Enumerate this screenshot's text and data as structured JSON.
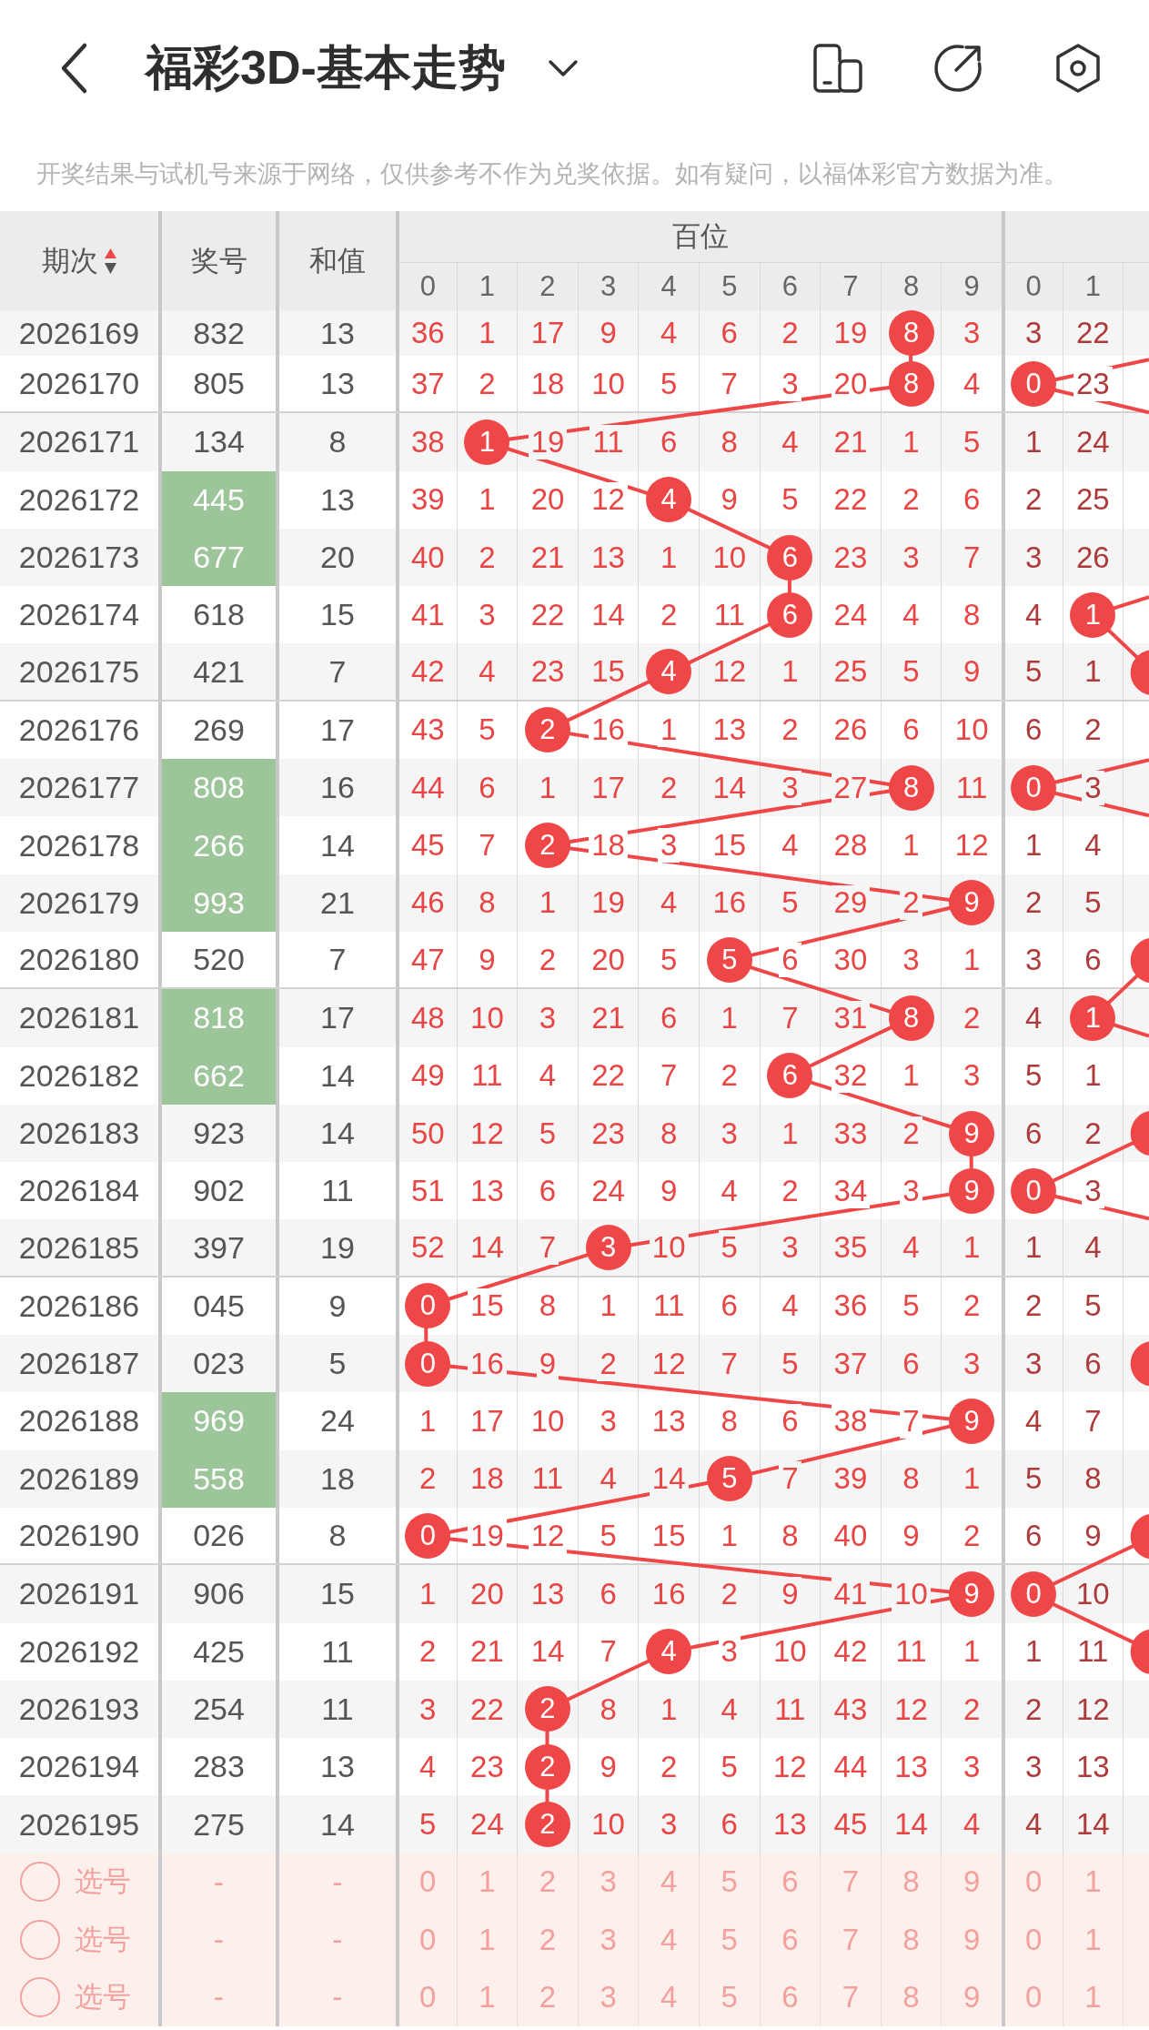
{
  "header": {
    "title": "福彩3D-基本走势"
  },
  "notice": "开奖结果与试机号来源于网络，仅供参考不作为兑奖依据。如有疑问，以福体彩官方数据为准。",
  "table": {
    "columns": [
      {
        "label": "期次",
        "sort_ascending": true
      },
      {
        "label": "奖号"
      },
      {
        "label": "和值"
      }
    ],
    "digit_groups": [
      {
        "label": "百位",
        "digits": [
          "0",
          "1",
          "2",
          "3",
          "4",
          "5",
          "6",
          "7",
          "8",
          "9"
        ]
      },
      {
        "digits": [
          "0",
          "1"
        ]
      }
    ],
    "rows": [
      {
        "period": "2026169",
        "number": "832",
        "highlighted": false,
        "sum": "13",
        "section_end": false,
        "hundreds": [
          {
            "value": "36",
            "hit": false
          },
          {
            "value": "1",
            "hit": false
          },
          {
            "value": "17",
            "hit": false
          },
          {
            "value": "9",
            "hit": false
          },
          {
            "value": "4",
            "hit": false
          },
          {
            "value": "6",
            "hit": false
          },
          {
            "value": "2",
            "hit": false
          },
          {
            "value": "19",
            "hit": false
          },
          {
            "value": "8",
            "hit": true
          },
          {
            "value": "3",
            "hit": false
          }
        ],
        "tens": [
          {
            "value": "3",
            "hit": false
          },
          {
            "value": "22",
            "hit": false
          },
          {
            "hit": false
          }
        ]
      },
      {
        "period": "2026170",
        "number": "805",
        "highlighted": false,
        "sum": "13",
        "section_end": true,
        "hundreds": [
          {
            "value": "37",
            "hit": false
          },
          {
            "value": "2",
            "hit": false
          },
          {
            "value": "18",
            "hit": false
          },
          {
            "value": "10",
            "hit": false
          },
          {
            "value": "5",
            "hit": false
          },
          {
            "value": "7",
            "hit": false
          },
          {
            "value": "3",
            "hit": false
          },
          {
            "value": "20",
            "hit": false
          },
          {
            "value": "8",
            "hit": true
          },
          {
            "value": "4",
            "hit": false
          }
        ],
        "tens": [
          {
            "value": "0",
            "hit": true
          },
          {
            "value": "23",
            "hit": false
          },
          {
            "hit": false
          }
        ]
      },
      {
        "period": "2026171",
        "number": "134",
        "highlighted": false,
        "sum": "8",
        "section_end": false,
        "hundreds": [
          {
            "value": "38",
            "hit": false
          },
          {
            "value": "1",
            "hit": true
          },
          {
            "value": "19",
            "hit": false
          },
          {
            "value": "11",
            "hit": false
          },
          {
            "value": "6",
            "hit": false
          },
          {
            "value": "8",
            "hit": false
          },
          {
            "value": "4",
            "hit": false
          },
          {
            "value": "21",
            "hit": false
          },
          {
            "value": "1",
            "hit": false
          },
          {
            "value": "5",
            "hit": false
          }
        ],
        "tens": [
          {
            "value": "1",
            "hit": false
          },
          {
            "value": "24",
            "hit": false
          },
          {
            "hit": false
          }
        ]
      },
      {
        "period": "2026172",
        "number": "445",
        "highlighted": true,
        "sum": "13",
        "section_end": false,
        "hundreds": [
          {
            "value": "39",
            "hit": false
          },
          {
            "value": "1",
            "hit": false
          },
          {
            "value": "20",
            "hit": false
          },
          {
            "value": "12",
            "hit": false
          },
          {
            "value": "4",
            "hit": true
          },
          {
            "value": "9",
            "hit": false
          },
          {
            "value": "5",
            "hit": false
          },
          {
            "value": "22",
            "hit": false
          },
          {
            "value": "2",
            "hit": false
          },
          {
            "value": "6",
            "hit": false
          }
        ],
        "tens": [
          {
            "value": "2",
            "hit": false
          },
          {
            "value": "25",
            "hit": false
          },
          {
            "hit": false
          }
        ]
      },
      {
        "period": "2026173",
        "number": "677",
        "highlighted": true,
        "sum": "20",
        "section_end": false,
        "hundreds": [
          {
            "value": "40",
            "hit": false
          },
          {
            "value": "2",
            "hit": false
          },
          {
            "value": "21",
            "hit": false
          },
          {
            "value": "13",
            "hit": false
          },
          {
            "value": "1",
            "hit": false
          },
          {
            "value": "10",
            "hit": false
          },
          {
            "value": "6",
            "hit": true
          },
          {
            "value": "23",
            "hit": false
          },
          {
            "value": "3",
            "hit": false
          },
          {
            "value": "7",
            "hit": false
          }
        ],
        "tens": [
          {
            "value": "3",
            "hit": false
          },
          {
            "value": "26",
            "hit": false
          },
          {
            "hit": false
          }
        ]
      },
      {
        "period": "2026174",
        "number": "618",
        "highlighted": false,
        "sum": "15",
        "section_end": false,
        "hundreds": [
          {
            "value": "41",
            "hit": false
          },
          {
            "value": "3",
            "hit": false
          },
          {
            "value": "22",
            "hit": false
          },
          {
            "value": "14",
            "hit": false
          },
          {
            "value": "2",
            "hit": false
          },
          {
            "value": "11",
            "hit": false
          },
          {
            "value": "6",
            "hit": true
          },
          {
            "value": "24",
            "hit": false
          },
          {
            "value": "4",
            "hit": false
          },
          {
            "value": "8",
            "hit": false
          }
        ],
        "tens": [
          {
            "value": "4",
            "hit": false
          },
          {
            "value": "1",
            "hit": true
          },
          {
            "hit": false
          }
        ]
      },
      {
        "period": "2026175",
        "number": "421",
        "highlighted": false,
        "sum": "7",
        "section_end": true,
        "hundreds": [
          {
            "value": "42",
            "hit": false
          },
          {
            "value": "4",
            "hit": false
          },
          {
            "value": "23",
            "hit": false
          },
          {
            "value": "15",
            "hit": false
          },
          {
            "value": "4",
            "hit": true
          },
          {
            "value": "12",
            "hit": false
          },
          {
            "value": "1",
            "hit": false
          },
          {
            "value": "25",
            "hit": false
          },
          {
            "value": "5",
            "hit": false
          },
          {
            "value": "9",
            "hit": false
          }
        ],
        "tens": [
          {
            "value": "5",
            "hit": false
          },
          {
            "value": "1",
            "hit": false
          },
          {
            "hit": true
          }
        ]
      },
      {
        "period": "2026176",
        "number": "269",
        "highlighted": false,
        "sum": "17",
        "section_end": false,
        "hundreds": [
          {
            "value": "43",
            "hit": false
          },
          {
            "value": "5",
            "hit": false
          },
          {
            "value": "2",
            "hit": true
          },
          {
            "value": "16",
            "hit": false
          },
          {
            "value": "1",
            "hit": false
          },
          {
            "value": "13",
            "hit": false
          },
          {
            "value": "2",
            "hit": false
          },
          {
            "value": "26",
            "hit": false
          },
          {
            "value": "6",
            "hit": false
          },
          {
            "value": "10",
            "hit": false
          }
        ],
        "tens": [
          {
            "value": "6",
            "hit": false
          },
          {
            "value": "2",
            "hit": false
          },
          {
            "hit": false
          }
        ]
      },
      {
        "period": "2026177",
        "number": "808",
        "highlighted": true,
        "sum": "16",
        "section_end": false,
        "hundreds": [
          {
            "value": "44",
            "hit": false
          },
          {
            "value": "6",
            "hit": false
          },
          {
            "value": "1",
            "hit": false
          },
          {
            "value": "17",
            "hit": false
          },
          {
            "value": "2",
            "hit": false
          },
          {
            "value": "14",
            "hit": false
          },
          {
            "value": "3",
            "hit": false
          },
          {
            "value": "27",
            "hit": false
          },
          {
            "value": "8",
            "hit": true
          },
          {
            "value": "11",
            "hit": false
          }
        ],
        "tens": [
          {
            "value": "0",
            "hit": true
          },
          {
            "value": "3",
            "hit": false
          },
          {
            "hit": false
          }
        ]
      },
      {
        "period": "2026178",
        "number": "266",
        "highlighted": true,
        "sum": "14",
        "section_end": false,
        "hundreds": [
          {
            "value": "45",
            "hit": false
          },
          {
            "value": "7",
            "hit": false
          },
          {
            "value": "2",
            "hit": true
          },
          {
            "value": "18",
            "hit": false
          },
          {
            "value": "3",
            "hit": false
          },
          {
            "value": "15",
            "hit": false
          },
          {
            "value": "4",
            "hit": false
          },
          {
            "value": "28",
            "hit": false
          },
          {
            "value": "1",
            "hit": false
          },
          {
            "value": "12",
            "hit": false
          }
        ],
        "tens": [
          {
            "value": "1",
            "hit": false
          },
          {
            "value": "4",
            "hit": false
          },
          {
            "hit": false
          }
        ]
      },
      {
        "period": "2026179",
        "number": "993",
        "highlighted": true,
        "sum": "21",
        "section_end": false,
        "hundreds": [
          {
            "value": "46",
            "hit": false
          },
          {
            "value": "8",
            "hit": false
          },
          {
            "value": "1",
            "hit": false
          },
          {
            "value": "19",
            "hit": false
          },
          {
            "value": "4",
            "hit": false
          },
          {
            "value": "16",
            "hit": false
          },
          {
            "value": "5",
            "hit": false
          },
          {
            "value": "29",
            "hit": false
          },
          {
            "value": "2",
            "hit": false
          },
          {
            "value": "9",
            "hit": true
          }
        ],
        "tens": [
          {
            "value": "2",
            "hit": false
          },
          {
            "value": "5",
            "hit": false
          },
          {
            "hit": false
          }
        ]
      },
      {
        "period": "2026180",
        "number": "520",
        "highlighted": false,
        "sum": "7",
        "section_end": true,
        "hundreds": [
          {
            "value": "47",
            "hit": false
          },
          {
            "value": "9",
            "hit": false
          },
          {
            "value": "2",
            "hit": false
          },
          {
            "value": "20",
            "hit": false
          },
          {
            "value": "5",
            "hit": false
          },
          {
            "value": "5",
            "hit": true
          },
          {
            "value": "6",
            "hit": false
          },
          {
            "value": "30",
            "hit": false
          },
          {
            "value": "3",
            "hit": false
          },
          {
            "value": "1",
            "hit": false
          }
        ],
        "tens": [
          {
            "value": "3",
            "hit": false
          },
          {
            "value": "6",
            "hit": false
          },
          {
            "hit": true
          }
        ]
      },
      {
        "period": "2026181",
        "number": "818",
        "highlighted": true,
        "sum": "17",
        "section_end": false,
        "hundreds": [
          {
            "value": "48",
            "hit": false
          },
          {
            "value": "10",
            "hit": false
          },
          {
            "value": "3",
            "hit": false
          },
          {
            "value": "21",
            "hit": false
          },
          {
            "value": "6",
            "hit": false
          },
          {
            "value": "1",
            "hit": false
          },
          {
            "value": "7",
            "hit": false
          },
          {
            "value": "31",
            "hit": false
          },
          {
            "value": "8",
            "hit": true
          },
          {
            "value": "2",
            "hit": false
          }
        ],
        "tens": [
          {
            "value": "4",
            "hit": false
          },
          {
            "value": "1",
            "hit": true
          },
          {
            "hit": false
          }
        ]
      },
      {
        "period": "2026182",
        "number": "662",
        "highlighted": true,
        "sum": "14",
        "section_end": false,
        "hundreds": [
          {
            "value": "49",
            "hit": false
          },
          {
            "value": "11",
            "hit": false
          },
          {
            "value": "4",
            "hit": false
          },
          {
            "value": "22",
            "hit": false
          },
          {
            "value": "7",
            "hit": false
          },
          {
            "value": "2",
            "hit": false
          },
          {
            "value": "6",
            "hit": true
          },
          {
            "value": "32",
            "hit": false
          },
          {
            "value": "1",
            "hit": false
          },
          {
            "value": "3",
            "hit": false
          }
        ],
        "tens": [
          {
            "value": "5",
            "hit": false
          },
          {
            "value": "1",
            "hit": false
          },
          {
            "hit": false
          }
        ]
      },
      {
        "period": "2026183",
        "number": "923",
        "highlighted": false,
        "sum": "14",
        "section_end": false,
        "hundreds": [
          {
            "value": "50",
            "hit": false
          },
          {
            "value": "12",
            "hit": false
          },
          {
            "value": "5",
            "hit": false
          },
          {
            "value": "23",
            "hit": false
          },
          {
            "value": "8",
            "hit": false
          },
          {
            "value": "3",
            "hit": false
          },
          {
            "value": "1",
            "hit": false
          },
          {
            "value": "33",
            "hit": false
          },
          {
            "value": "2",
            "hit": false
          },
          {
            "value": "9",
            "hit": true
          }
        ],
        "tens": [
          {
            "value": "6",
            "hit": false
          },
          {
            "value": "2",
            "hit": false
          },
          {
            "hit": true
          }
        ]
      },
      {
        "period": "2026184",
        "number": "902",
        "highlighted": false,
        "sum": "11",
        "section_end": false,
        "hundreds": [
          {
            "value": "51",
            "hit": false
          },
          {
            "value": "13",
            "hit": false
          },
          {
            "value": "6",
            "hit": false
          },
          {
            "value": "24",
            "hit": false
          },
          {
            "value": "9",
            "hit": false
          },
          {
            "value": "4",
            "hit": false
          },
          {
            "value": "2",
            "hit": false
          },
          {
            "value": "34",
            "hit": false
          },
          {
            "value": "3",
            "hit": false
          },
          {
            "value": "9",
            "hit": true
          }
        ],
        "tens": [
          {
            "value": "0",
            "hit": true
          },
          {
            "value": "3",
            "hit": false
          },
          {
            "hit": false
          }
        ]
      },
      {
        "period": "2026185",
        "number": "397",
        "highlighted": false,
        "sum": "19",
        "section_end": true,
        "hundreds": [
          {
            "value": "52",
            "hit": false
          },
          {
            "value": "14",
            "hit": false
          },
          {
            "value": "7",
            "hit": false
          },
          {
            "value": "3",
            "hit": true
          },
          {
            "value": "10",
            "hit": false
          },
          {
            "value": "5",
            "hit": false
          },
          {
            "value": "3",
            "hit": false
          },
          {
            "value": "35",
            "hit": false
          },
          {
            "value": "4",
            "hit": false
          },
          {
            "value": "1",
            "hit": false
          }
        ],
        "tens": [
          {
            "value": "1",
            "hit": false
          },
          {
            "value": "4",
            "hit": false
          },
          {
            "hit": false
          }
        ]
      },
      {
        "period": "2026186",
        "number": "045",
        "highlighted": false,
        "sum": "9",
        "section_end": false,
        "hundreds": [
          {
            "value": "0",
            "hit": true
          },
          {
            "value": "15",
            "hit": false
          },
          {
            "value": "8",
            "hit": false
          },
          {
            "value": "1",
            "hit": false
          },
          {
            "value": "11",
            "hit": false
          },
          {
            "value": "6",
            "hit": false
          },
          {
            "value": "4",
            "hit": false
          },
          {
            "value": "36",
            "hit": false
          },
          {
            "value": "5",
            "hit": false
          },
          {
            "value": "2",
            "hit": false
          }
        ],
        "tens": [
          {
            "value": "2",
            "hit": false
          },
          {
            "value": "5",
            "hit": false
          },
          {
            "hit": false
          }
        ]
      },
      {
        "period": "2026187",
        "number": "023",
        "highlighted": false,
        "sum": "5",
        "section_end": false,
        "hundreds": [
          {
            "value": "0",
            "hit": true
          },
          {
            "value": "16",
            "hit": false
          },
          {
            "value": "9",
            "hit": false
          },
          {
            "value": "2",
            "hit": false
          },
          {
            "value": "12",
            "hit": false
          },
          {
            "value": "7",
            "hit": false
          },
          {
            "value": "5",
            "hit": false
          },
          {
            "value": "37",
            "hit": false
          },
          {
            "value": "6",
            "hit": false
          },
          {
            "value": "3",
            "hit": false
          }
        ],
        "tens": [
          {
            "value": "3",
            "hit": false
          },
          {
            "value": "6",
            "hit": false
          },
          {
            "hit": true
          }
        ]
      },
      {
        "period": "2026188",
        "number": "969",
        "highlighted": true,
        "sum": "24",
        "section_end": false,
        "hundreds": [
          {
            "value": "1",
            "hit": false
          },
          {
            "value": "17",
            "hit": false
          },
          {
            "value": "10",
            "hit": false
          },
          {
            "value": "3",
            "hit": false
          },
          {
            "value": "13",
            "hit": false
          },
          {
            "value": "8",
            "hit": false
          },
          {
            "value": "6",
            "hit": false
          },
          {
            "value": "38",
            "hit": false
          },
          {
            "value": "7",
            "hit": false
          },
          {
            "value": "9",
            "hit": true
          }
        ],
        "tens": [
          {
            "value": "4",
            "hit": false
          },
          {
            "value": "7",
            "hit": false
          },
          {
            "hit": false
          }
        ]
      },
      {
        "period": "2026189",
        "number": "558",
        "highlighted": true,
        "sum": "18",
        "section_end": false,
        "hundreds": [
          {
            "value": "2",
            "hit": false
          },
          {
            "value": "18",
            "hit": false
          },
          {
            "value": "11",
            "hit": false
          },
          {
            "value": "4",
            "hit": false
          },
          {
            "value": "14",
            "hit": false
          },
          {
            "value": "5",
            "hit": true
          },
          {
            "value": "7",
            "hit": false
          },
          {
            "value": "39",
            "hit": false
          },
          {
            "value": "8",
            "hit": false
          },
          {
            "value": "1",
            "hit": false
          }
        ],
        "tens": [
          {
            "value": "5",
            "hit": false
          },
          {
            "value": "8",
            "hit": false
          },
          {
            "hit": false
          }
        ]
      },
      {
        "period": "2026190",
        "number": "026",
        "highlighted": false,
        "sum": "8",
        "section_end": true,
        "hundreds": [
          {
            "value": "0",
            "hit": true
          },
          {
            "value": "19",
            "hit": false
          },
          {
            "value": "12",
            "hit": false
          },
          {
            "value": "5",
            "hit": false
          },
          {
            "value": "15",
            "hit": false
          },
          {
            "value": "1",
            "hit": false
          },
          {
            "value": "8",
            "hit": false
          },
          {
            "value": "40",
            "hit": false
          },
          {
            "value": "9",
            "hit": false
          },
          {
            "value": "2",
            "hit": false
          }
        ],
        "tens": [
          {
            "value": "6",
            "hit": false
          },
          {
            "value": "9",
            "hit": false
          },
          {
            "hit": true
          }
        ]
      },
      {
        "period": "2026191",
        "number": "906",
        "highlighted": false,
        "sum": "15",
        "section_end": false,
        "hundreds": [
          {
            "value": "1",
            "hit": false
          },
          {
            "value": "20",
            "hit": false
          },
          {
            "value": "13",
            "hit": false
          },
          {
            "value": "6",
            "hit": false
          },
          {
            "value": "16",
            "hit": false
          },
          {
            "value": "2",
            "hit": false
          },
          {
            "value": "9",
            "hit": false
          },
          {
            "value": "41",
            "hit": false
          },
          {
            "value": "10",
            "hit": false
          },
          {
            "value": "9",
            "hit": true
          }
        ],
        "tens": [
          {
            "value": "0",
            "hit": true
          },
          {
            "value": "10",
            "hit": false
          },
          {
            "hit": false
          }
        ]
      },
      {
        "period": "2026192",
        "number": "425",
        "highlighted": false,
        "sum": "11",
        "section_end": false,
        "hundreds": [
          {
            "value": "2",
            "hit": false
          },
          {
            "value": "21",
            "hit": false
          },
          {
            "value": "14",
            "hit": false
          },
          {
            "value": "7",
            "hit": false
          },
          {
            "value": "4",
            "hit": true
          },
          {
            "value": "3",
            "hit": false
          },
          {
            "value": "10",
            "hit": false
          },
          {
            "value": "42",
            "hit": false
          },
          {
            "value": "11",
            "hit": false
          },
          {
            "value": "1",
            "hit": false
          }
        ],
        "tens": [
          {
            "value": "1",
            "hit": false
          },
          {
            "value": "11",
            "hit": false
          },
          {
            "hit": true
          }
        ]
      },
      {
        "period": "2026193",
        "number": "254",
        "highlighted": false,
        "sum": "11",
        "section_end": false,
        "hundreds": [
          {
            "value": "3",
            "hit": false
          },
          {
            "value": "22",
            "hit": false
          },
          {
            "value": "2",
            "hit": true
          },
          {
            "value": "8",
            "hit": false
          },
          {
            "value": "1",
            "hit": false
          },
          {
            "value": "4",
            "hit": false
          },
          {
            "value": "11",
            "hit": false
          },
          {
            "value": "43",
            "hit": false
          },
          {
            "value": "12",
            "hit": false
          },
          {
            "value": "2",
            "hit": false
          }
        ],
        "tens": [
          {
            "value": "2",
            "hit": false
          },
          {
            "value": "12",
            "hit": false
          },
          {
            "hit": false
          }
        ]
      },
      {
        "period": "2026194",
        "number": "283",
        "highlighted": false,
        "sum": "13",
        "section_end": false,
        "hundreds": [
          {
            "value": "4",
            "hit": false
          },
          {
            "value": "23",
            "hit": false
          },
          {
            "value": "2",
            "hit": true
          },
          {
            "value": "9",
            "hit": false
          },
          {
            "value": "2",
            "hit": false
          },
          {
            "value": "5",
            "hit": false
          },
          {
            "value": "12",
            "hit": false
          },
          {
            "value": "44",
            "hit": false
          },
          {
            "value": "13",
            "hit": false
          },
          {
            "value": "3",
            "hit": false
          }
        ],
        "tens": [
          {
            "value": "3",
            "hit": false
          },
          {
            "value": "13",
            "hit": false
          },
          {
            "hit": false
          }
        ]
      },
      {
        "period": "2026195",
        "number": "275",
        "highlighted": false,
        "sum": "14",
        "section_end": false,
        "hundreds": [
          {
            "value": "5",
            "hit": false
          },
          {
            "value": "24",
            "hit": false
          },
          {
            "value": "2",
            "hit": true
          },
          {
            "value": "10",
            "hit": false
          },
          {
            "value": "3",
            "hit": false
          },
          {
            "value": "6",
            "hit": false
          },
          {
            "value": "13",
            "hit": false
          },
          {
            "value": "45",
            "hit": false
          },
          {
            "value": "14",
            "hit": false
          },
          {
            "value": "4",
            "hit": false
          }
        ],
        "tens": [
          {
            "value": "4",
            "hit": false
          },
          {
            "value": "14",
            "hit": false
          },
          {
            "hit": false
          }
        ]
      }
    ],
    "pick_rows": [
      {
        "label": "选号",
        "checked": false,
        "number": "-",
        "sum": "-",
        "hundreds": [
          "0",
          "1",
          "2",
          "3",
          "4",
          "5",
          "6",
          "7",
          "8",
          "9"
        ],
        "tens": [
          "0",
          "1"
        ]
      },
      {
        "label": "选号",
        "checked": false,
        "number": "-",
        "sum": "-",
        "hundreds": [
          "0",
          "1",
          "2",
          "3",
          "4",
          "5",
          "6",
          "7",
          "8",
          "9"
        ],
        "tens": [
          "0",
          "1"
        ]
      },
      {
        "label": "选号",
        "checked": false,
        "number": "-",
        "sum": "-",
        "hundreds": [
          "0",
          "1",
          "2",
          "3",
          "4",
          "5",
          "6",
          "7",
          "8",
          "9"
        ],
        "tens": [
          "0",
          "1"
        ]
      }
    ]
  }
}
